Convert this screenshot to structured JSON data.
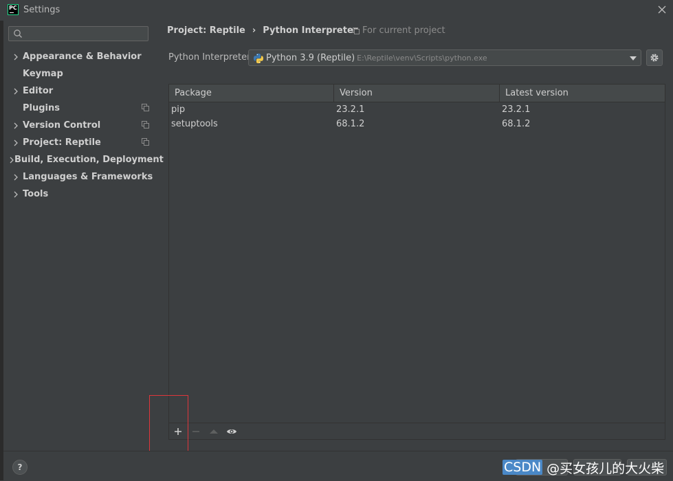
{
  "window": {
    "logo_text": "PC",
    "title": "Settings"
  },
  "sidebar": {
    "search_placeholder": "",
    "items": [
      {
        "label": "Appearance & Behavior",
        "expandable": true,
        "project_icon": false
      },
      {
        "label": "Keymap",
        "expandable": false,
        "project_icon": false
      },
      {
        "label": "Editor",
        "expandable": true,
        "project_icon": false
      },
      {
        "label": "Plugins",
        "expandable": false,
        "project_icon": true
      },
      {
        "label": "Version Control",
        "expandable": true,
        "project_icon": true
      },
      {
        "label": "Project: Reptile",
        "expandable": true,
        "project_icon": true
      },
      {
        "label": "Build, Execution, Deployment",
        "expandable": true,
        "project_icon": false
      },
      {
        "label": "Languages & Frameworks",
        "expandable": true,
        "project_icon": false
      },
      {
        "label": "Tools",
        "expandable": true,
        "project_icon": false
      }
    ]
  },
  "breadcrumb": {
    "parent": "Project: Reptile",
    "separator": "›",
    "current": "Python Interpreter",
    "scope": "For current project"
  },
  "interpreter": {
    "label": "Python Interpreter:",
    "name": "Python 3.9 (Reptile)",
    "path": "E:\\Reptile\\venv\\Scripts\\python.exe"
  },
  "packages": {
    "columns": [
      "Package",
      "Version",
      "Latest version"
    ],
    "rows": [
      {
        "package": "pip",
        "version": "23.2.1",
        "latest": "23.2.1"
      },
      {
        "package": "setuptools",
        "version": "68.1.2",
        "latest": "68.1.2"
      }
    ]
  },
  "help": {
    "label": "?"
  },
  "watermark": {
    "brand": "CSDN",
    "handle": "@买女孩儿的大火柴"
  },
  "colors": {
    "background": "#3c3f41",
    "highlight_border": "#e0363b",
    "logo_green": "#21d789"
  }
}
